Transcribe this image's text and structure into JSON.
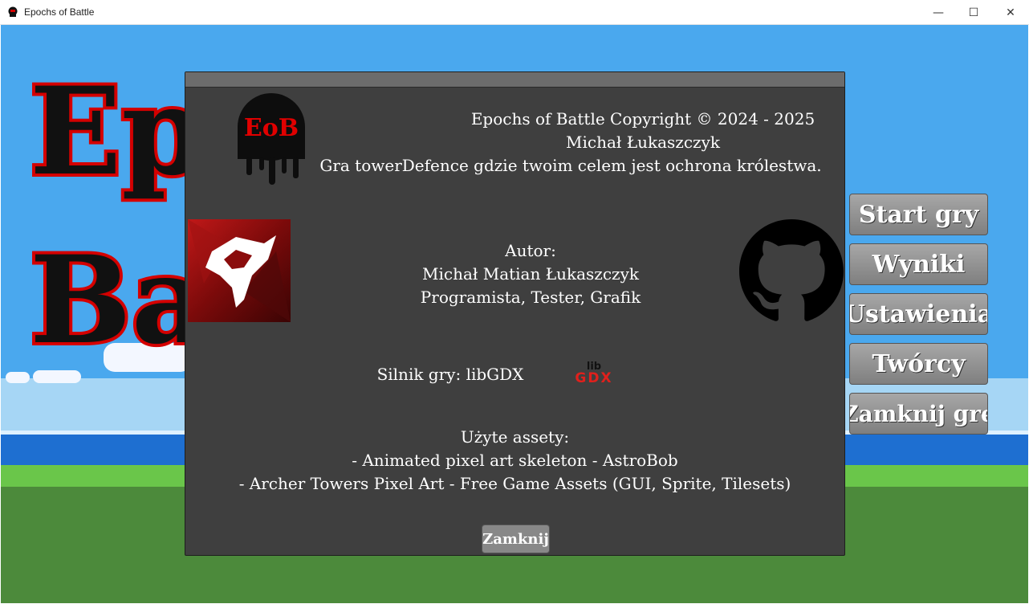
{
  "window": {
    "title": "Epochs of Battle",
    "minimize_label": "—",
    "maximize_label": "☐",
    "close_label": "✕"
  },
  "background": {
    "title_line1": "Ep",
    "title_line2": "Ba"
  },
  "menu": {
    "items": [
      {
        "label": "Start gry"
      },
      {
        "label": "Wyniki"
      },
      {
        "label": "Ustawienia"
      },
      {
        "label": "Twórcy"
      },
      {
        "label": "Zamknij grę"
      }
    ]
  },
  "dialog": {
    "logo_text": "EoB",
    "copyright_lines": [
      "Epochs of Battle Copyright © 2024 - 2025",
      "Michał Łukaszczyk",
      "Gra towerDefence gdzie twoim celem jest ochrona królestwa."
    ],
    "author_lines": [
      "Autor:",
      "Michał Matian Łukaszczyk",
      "Programista, Tester, Grafik"
    ],
    "engine_label": "Silnik gry: libGDX",
    "gdx_logo_top": "lib",
    "gdx_logo_bottom": "GDX",
    "assets_lines": [
      "Użyte assety:",
      "- Animated pixel art skeleton - AstroBob",
      "- Archer Towers Pixel Art - Free Game Assets (GUI, Sprite, Tilesets)"
    ],
    "close_label": "Zamknij"
  },
  "colors": {
    "title_red": "#d40000",
    "dialog_bg": "#3f3f3f",
    "button_gray": "#888888",
    "sky": "#4aa8ee",
    "grass": "#4c8a3b"
  },
  "icons": [
    "eob-logo",
    "wolf-logo",
    "github-icon",
    "libgdx-logo",
    "app-icon"
  ]
}
